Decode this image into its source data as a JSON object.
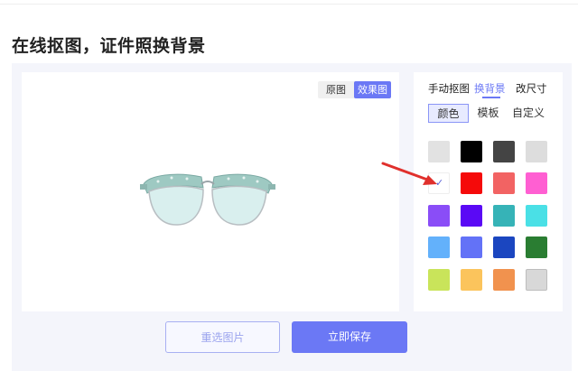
{
  "page": {
    "title": "在线抠图，证件照换背景"
  },
  "preview": {
    "view_options": [
      "原图",
      "效果图"
    ],
    "selected_view": "效果图"
  },
  "sidebar": {
    "tabs": [
      "手动抠图",
      "换背景",
      "改尺寸"
    ],
    "active_tab": "换背景",
    "subtabs": [
      "颜色",
      "模板",
      "自定义"
    ],
    "active_subtab": "颜色",
    "selected_swatch": 4,
    "swatches": [
      {
        "color": "#e2e2e2"
      },
      {
        "color": "#000000"
      },
      {
        "color": "#444444"
      },
      {
        "color": "#dddddd"
      },
      {
        "color": "#ffffff"
      },
      {
        "color": "#f50a0a"
      },
      {
        "color": "#f26363"
      },
      {
        "color": "#ff5fd2"
      },
      {
        "color": "#8a4df7"
      },
      {
        "color": "#5a09f5"
      },
      {
        "color": "#36b3b7"
      },
      {
        "color": "#4ae0e6"
      },
      {
        "color": "#63b1fb"
      },
      {
        "color": "#6372f7"
      },
      {
        "color": "#1b46c0"
      },
      {
        "color": "#2a7d32"
      },
      {
        "color": "#c9e45a"
      },
      {
        "color": "#fbc45c"
      },
      {
        "color": "#f1924e"
      },
      {
        "color": "#d8d8d8"
      }
    ]
  },
  "actions": {
    "reselect_label": "重选图片",
    "save_label": "立即保存"
  },
  "colors": {
    "accent": "#6b78f5",
    "annotation_arrow": "#e0302c",
    "workspace_bg": "#f4f5fb"
  }
}
